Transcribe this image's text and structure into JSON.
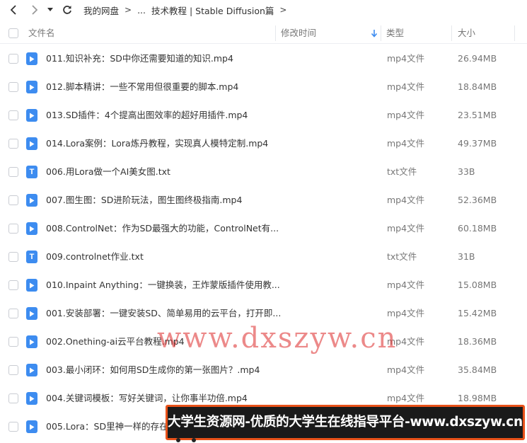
{
  "breadcrumb": {
    "items": [
      "我的网盘",
      "...",
      "技术教程 | Stable Diffusion篇"
    ]
  },
  "table": {
    "columns": {
      "name": "文件名",
      "modified": "修改时间",
      "type": "类型",
      "size": "大小"
    },
    "rows": [
      {
        "name": "011.知识补充：SD中你还需要知道的知识.mp4",
        "type": "mp4文件",
        "size": "26.94MB",
        "icon": "video-file-icon"
      },
      {
        "name": "012.脚本精讲：一些不常用但很重要的脚本.mp4",
        "type": "mp4文件",
        "size": "18.84MB",
        "icon": "video-file-icon"
      },
      {
        "name": "013.SD插件：4个提高出图效率的超好用插件.mp4",
        "type": "mp4文件",
        "size": "23.51MB",
        "icon": "video-file-icon"
      },
      {
        "name": "014.Lora案例：Lora炼丹教程，实现真人模特定制.mp4",
        "type": "mp4文件",
        "size": "49.37MB",
        "icon": "video-file-icon"
      },
      {
        "name": "006.用Lora做一个AI美女图.txt",
        "type": "txt文件",
        "size": "33B",
        "icon": "text-file-icon"
      },
      {
        "name": "007.图生图：SD进阶玩法，图生图终极指南.mp4",
        "type": "mp4文件",
        "size": "52.36MB",
        "icon": "video-file-icon"
      },
      {
        "name": "008.ControlNet：作为SD最强大的功能，ControlNet有...",
        "type": "mp4文件",
        "size": "60.18MB",
        "icon": "video-file-icon"
      },
      {
        "name": "009.controlnet作业.txt",
        "type": "txt文件",
        "size": "31B",
        "icon": "text-file-icon"
      },
      {
        "name": "010.Inpaint Anything：一键换装，王炸蒙版插件使用教...",
        "type": "mp4文件",
        "size": "15.08MB",
        "icon": "video-file-icon"
      },
      {
        "name": "001.安装部署：一键安装SD、简单易用的云平台，打开即...",
        "type": "mp4文件",
        "size": "15.42MB",
        "icon": "video-file-icon"
      },
      {
        "name": "002.Onething-ai云平台教程.mp4",
        "type": "mp4文件",
        "size": "18.36MB",
        "icon": "video-file-icon"
      },
      {
        "name": "003.最小闭环：如何用SD生成你的第一张图片？.mp4",
        "type": "mp4文件",
        "size": "35.84MB",
        "icon": "video-file-icon"
      },
      {
        "name": "004.关键词模板：写好关键词，让你事半功倍.mp4",
        "type": "mp4文件",
        "size": "18.98MB",
        "icon": "video-file-icon"
      },
      {
        "name": "005.Lora：SD里神一样的存在，",
        "type": "",
        "size": "",
        "icon": "video-file-icon"
      }
    ]
  },
  "overlay": {
    "watermark": "www.dxszyw.cn",
    "banner": "大学生资源网-优质的大学生在线指导平台-www.dxszyw.cn"
  },
  "colors": {
    "file_icon": "#3d8cf0",
    "watermark": "#dc2828",
    "banner_border": "#e8521a",
    "banner_bg": "#1a1a1a"
  }
}
